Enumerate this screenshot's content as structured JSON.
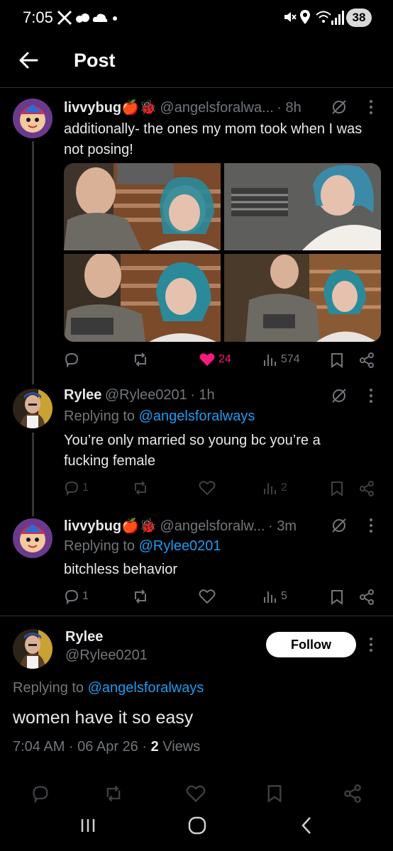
{
  "status_bar": {
    "time": "7:05",
    "battery": "38"
  },
  "header": {
    "title": "Post"
  },
  "posts": [
    {
      "name": "livvybug🍎🐞",
      "handle": "@angelsforalwa...",
      "time": "· 8h",
      "text": "additionally- the ones my mom took when I was not posing!",
      "stats": {
        "replies": "",
        "reposts": "",
        "likes": "24",
        "views": "574"
      },
      "liked": true
    },
    {
      "name": "Rylee",
      "handle": "@Rylee0201",
      "time": "· 1h",
      "replying_to_label": "Replying to",
      "replying_to": "@angelsforalways",
      "text": "You’re only married so young bc you’re a fucking female",
      "stats": {
        "replies": "1",
        "reposts": "",
        "likes": "",
        "views": "2"
      }
    },
    {
      "name": "livvybug🍎🐞",
      "handle": "@angelsforalw...",
      "time": "· 3m",
      "replying_to_label": "Replying to",
      "replying_to": "@Rylee0201",
      "text": "bitchless behavior",
      "stats": {
        "replies": "1",
        "reposts": "",
        "likes": "",
        "views": "5"
      }
    }
  ],
  "main_post": {
    "name": "Rylee",
    "handle": "@Rylee0201",
    "follow_label": "Follow",
    "replying_to_label": "Replying to",
    "replying_to": "@angelsforalways",
    "text": "women have it so easy",
    "timestamp": "7:04 AM · 06 Apr 26 · ",
    "views_count": "2",
    "views_label": " Views"
  },
  "colors": {
    "background": "#000000",
    "accent": "#1d9bf0",
    "like": "#f91880",
    "muted": "#71767b"
  }
}
